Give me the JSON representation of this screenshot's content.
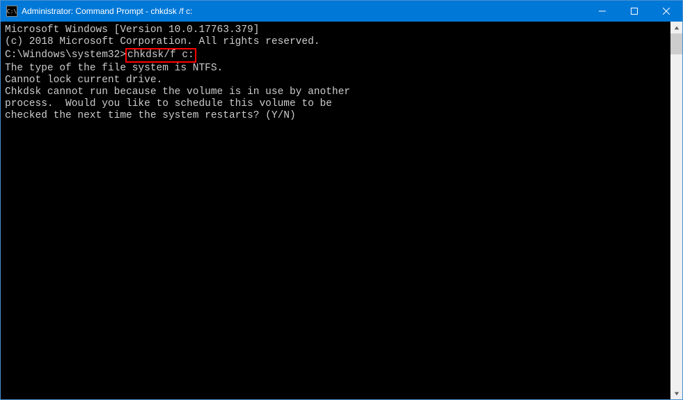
{
  "window": {
    "title": "Administrator: Command Prompt - chkdsk /f c:"
  },
  "terminal": {
    "line1": "Microsoft Windows [Version 10.0.17763.379]",
    "line2": "(c) 2018 Microsoft Corporation. All rights reserved.",
    "blank1": "",
    "prompt": "C:\\Windows\\system32>",
    "command": "chkdsk/f c:",
    "line4": "The type of the file system is NTFS.",
    "line5": "Cannot lock current drive.",
    "blank2": "",
    "line6": "Chkdsk cannot run because the volume is in use by another",
    "line7": "process.  Would you like to schedule this volume to be",
    "line8": "checked the next time the system restarts? (Y/N)"
  }
}
